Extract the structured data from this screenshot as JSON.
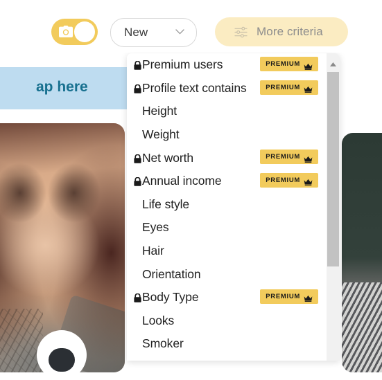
{
  "toolbar": {
    "photo_toggle": {
      "name": "photo-mode-toggle",
      "state": "on",
      "icon": "camera-icon"
    },
    "sort_select": {
      "value": "New",
      "chevron": "chevron-down-icon"
    },
    "more_criteria": {
      "label": "More criteria",
      "icon": "sliders-icon"
    }
  },
  "banner": {
    "text": "ap here"
  },
  "dropdown": {
    "items": [
      {
        "label": "Premium users",
        "locked": true,
        "badge": "PREMIUM"
      },
      {
        "label": "Profile text contains",
        "locked": true,
        "badge": "PREMIUM"
      },
      {
        "label": "Height",
        "locked": false,
        "badge": ""
      },
      {
        "label": "Weight",
        "locked": false,
        "badge": ""
      },
      {
        "label": "Net worth",
        "locked": true,
        "badge": "PREMIUM"
      },
      {
        "label": "Annual income",
        "locked": true,
        "badge": "PREMIUM"
      },
      {
        "label": "Life style",
        "locked": false,
        "badge": ""
      },
      {
        "label": "Eyes",
        "locked": false,
        "badge": ""
      },
      {
        "label": "Hair",
        "locked": false,
        "badge": ""
      },
      {
        "label": "Orientation",
        "locked": false,
        "badge": ""
      },
      {
        "label": "Body Type",
        "locked": true,
        "badge": "PREMIUM"
      },
      {
        "label": "Looks",
        "locked": false,
        "badge": ""
      },
      {
        "label": "Smoker",
        "locked": false,
        "badge": ""
      }
    ],
    "scrollbar": {
      "up_arrow": "scroll-up-arrow-icon"
    }
  },
  "colors": {
    "accent_yellow": "#f2cb5c",
    "soft_yellow": "#fbecc2",
    "banner_blue": "#bedcf0",
    "banner_text": "#17708f",
    "text_dark": "#1f1f1f",
    "muted_gray": "#8d8d8d"
  }
}
